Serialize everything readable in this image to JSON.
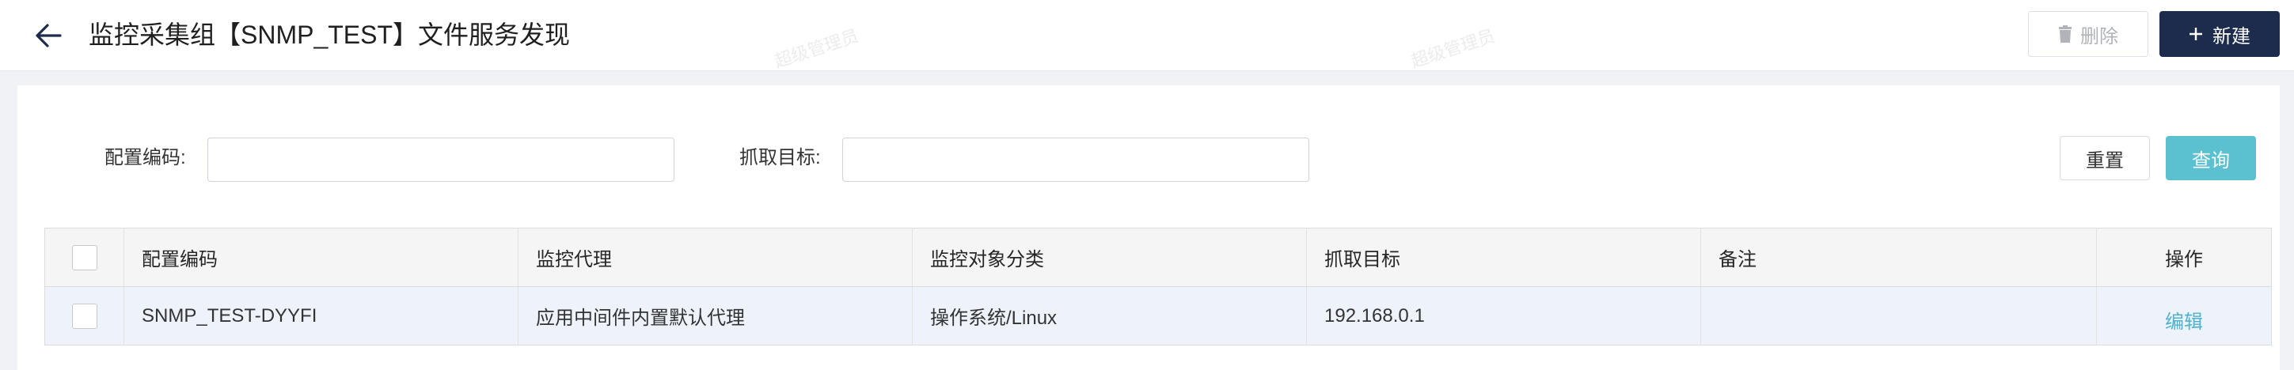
{
  "header": {
    "title": "监控采集组【SNMP_TEST】文件服务发现",
    "delete_label": "删除",
    "new_label": "新建"
  },
  "watermark": "超级管理员",
  "filters": {
    "config_code_label": "配置编码:",
    "config_code_value": "",
    "target_label": "抓取目标:",
    "target_value": "",
    "reset_label": "重置",
    "query_label": "查询"
  },
  "table": {
    "columns": [
      "配置编码",
      "监控代理",
      "监控对象分类",
      "抓取目标",
      "备注",
      "操作"
    ],
    "rows": [
      {
        "config_code": "SNMP_TEST-DYYFI",
        "agent": "应用中间件内置默认代理",
        "category": "操作系统/Linux",
        "target": "192.168.0.1",
        "remark": "",
        "action": "编辑"
      }
    ]
  },
  "colors": {
    "primary": "#1d2c4d",
    "query": "#5bc0d0",
    "link": "#4fb3cf"
  }
}
